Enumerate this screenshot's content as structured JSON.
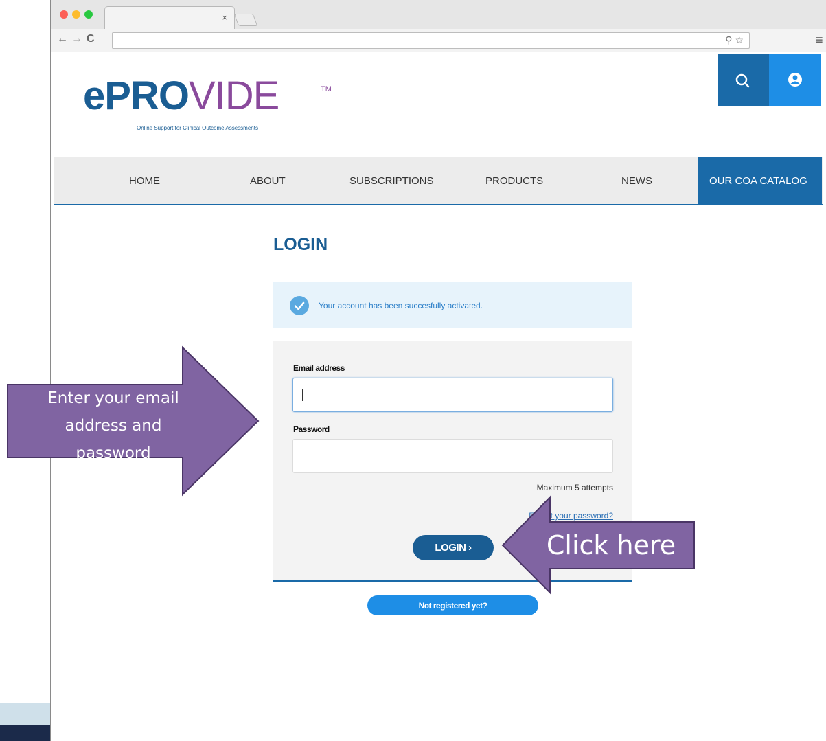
{
  "browser": {
    "tab_close": "×",
    "nav_back": "←",
    "nav_forward": "→",
    "nav_reload": "C",
    "url": "",
    "omnibox_icons": "⚲ ☆",
    "menu": "≡"
  },
  "header": {
    "logo_e": "e",
    "logo_pr": "PR",
    "logo_o": "O",
    "logo_vide": "VIDE",
    "logo_tm": "TM",
    "logo_tagline": "Online Support for Clinical Outcome Assessments"
  },
  "nav": {
    "items": [
      "HOME",
      "ABOUT",
      "SUBSCRIPTIONS",
      "PRODUCTS",
      "NEWS",
      "OUR COA CATALOG"
    ]
  },
  "login": {
    "title": "LOGIN",
    "alert_message": "Your account has been succesfully activated.",
    "email_label": "Email address",
    "email_value": "",
    "password_label": "Password",
    "password_value": "",
    "attempts_note": "Maximum 5 attempts",
    "forgot_link": "Forgot your password?",
    "login_button": "LOGIN ›",
    "register_button": "Not registered yet?"
  },
  "callouts": {
    "left_line1": "Enter your email",
    "left_line2": "address and",
    "left_line3": "password",
    "right": "Click here"
  },
  "colors": {
    "brand_blue": "#1a5d93",
    "accent_blue": "#1e8ee6",
    "brand_purple": "#8a4a9c",
    "callout_fill": "#8064a2",
    "callout_border": "#4a3566"
  }
}
